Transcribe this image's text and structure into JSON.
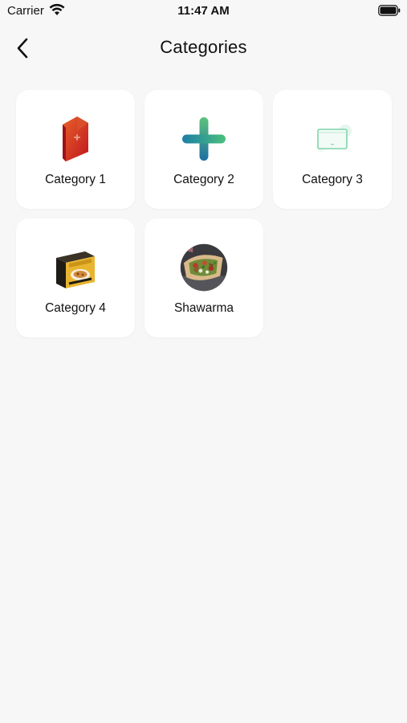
{
  "status_bar": {
    "carrier": "Carrier",
    "time": "11:47 AM"
  },
  "nav": {
    "title": "Categories"
  },
  "categories": [
    {
      "label": "Category 1",
      "icon": "red-tag-icon"
    },
    {
      "label": "Category 2",
      "icon": "plus-cross-icon"
    },
    {
      "label": "Category 3",
      "icon": "monitor-card-icon"
    },
    {
      "label": "Category 4",
      "icon": "food-box-icon"
    },
    {
      "label": "Shawarma",
      "icon": "shawarma-photo-icon"
    }
  ]
}
